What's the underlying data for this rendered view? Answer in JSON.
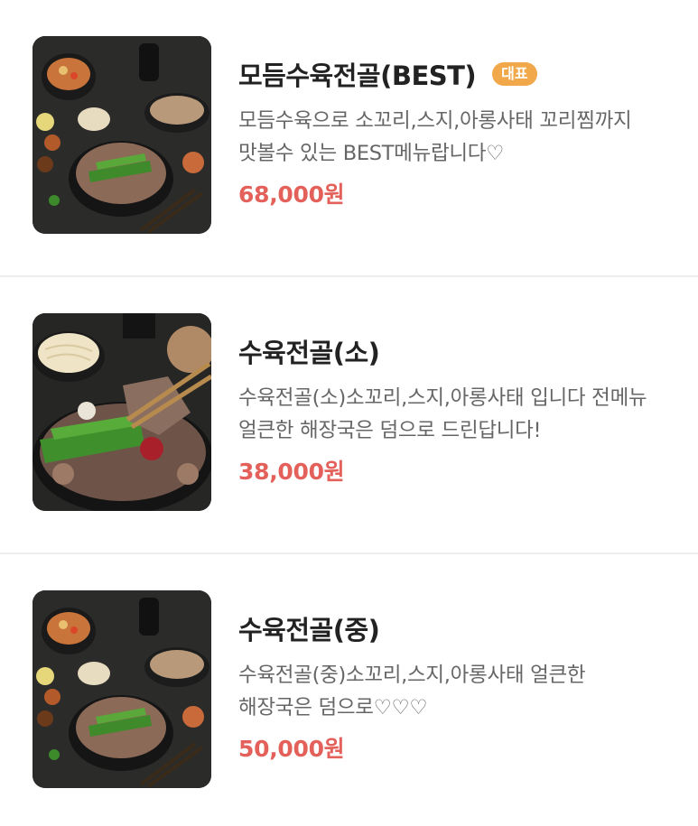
{
  "menu": {
    "items": [
      {
        "title": "모듬수육전골(BEST)",
        "badge": "대표",
        "description": "모듬수육으로 소꼬리,스지,아롱사태 꼬리찜까지 맛볼수 있는 BEST메뉴랍니다♡",
        "price": "68,000원",
        "image": "hotpot-spread-photo"
      },
      {
        "title": "수육전골(소)",
        "description": "수육전골(소)소꼬리,스지,아롱사태 입니다 전메뉴 얼큰한 해장국은 덤으로 드린답니다!",
        "price": "38,000원",
        "image": "hotpot-closeup-photo"
      },
      {
        "title": "수육전골(중)",
        "description": "수육전골(중)소꼬리,스지,아롱사태 얼큰한 해장국은 덤으로♡♡♡",
        "price": "50,000원",
        "image": "hotpot-spread-photo"
      }
    ]
  }
}
